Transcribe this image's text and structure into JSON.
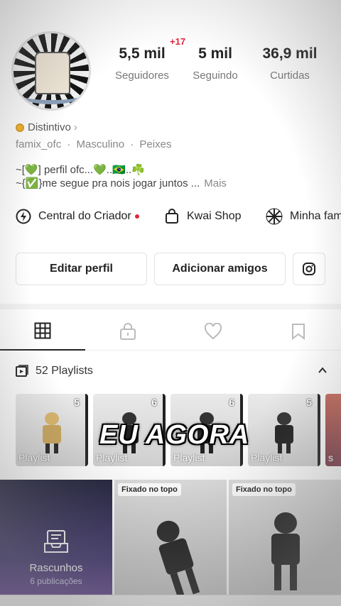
{
  "profile": {
    "username": "famix_ofc",
    "gender": "Masculino",
    "sign": "Peixes",
    "distintivo_label": "Distintivo",
    "bio_line1": "~[💚] perfil ofc...💚..🇧🇷..☘️",
    "bio_line2": "~{✅}me segue pra nois jogar juntos ...",
    "bio_more": "Mais"
  },
  "stats": {
    "followers_value": "5,5 mil",
    "followers_label": "Seguidores",
    "followers_badge": "+17",
    "following_value": "5 mil",
    "following_label": "Seguindo",
    "likes_value": "36,9 mil",
    "likes_label": "Curtidas"
  },
  "quicklinks": [
    {
      "label": "Central do Criador"
    },
    {
      "label": "Kwai Shop"
    },
    {
      "label": "Minha fam"
    }
  ],
  "buttons": {
    "edit_profile": "Editar perfil",
    "add_friends": "Adicionar amigos"
  },
  "playlists": {
    "header": "52 Playlists",
    "items": [
      {
        "count": "5",
        "label": "Playlist"
      },
      {
        "count": "6",
        "label": "Playlist"
      },
      {
        "count": "6",
        "label": "Playlist"
      },
      {
        "count": "5",
        "label": "Playlist"
      },
      {
        "count": "",
        "label": "s"
      }
    ],
    "overlay_text": "EU AGORA"
  },
  "grid": {
    "drafts_title": "Rascunhos",
    "drafts_sub": "6 publicações",
    "pinned_label": "Fixado no topo"
  },
  "colors": {
    "accent_red": "#e0263d",
    "badge_gold": "#f0b429"
  }
}
